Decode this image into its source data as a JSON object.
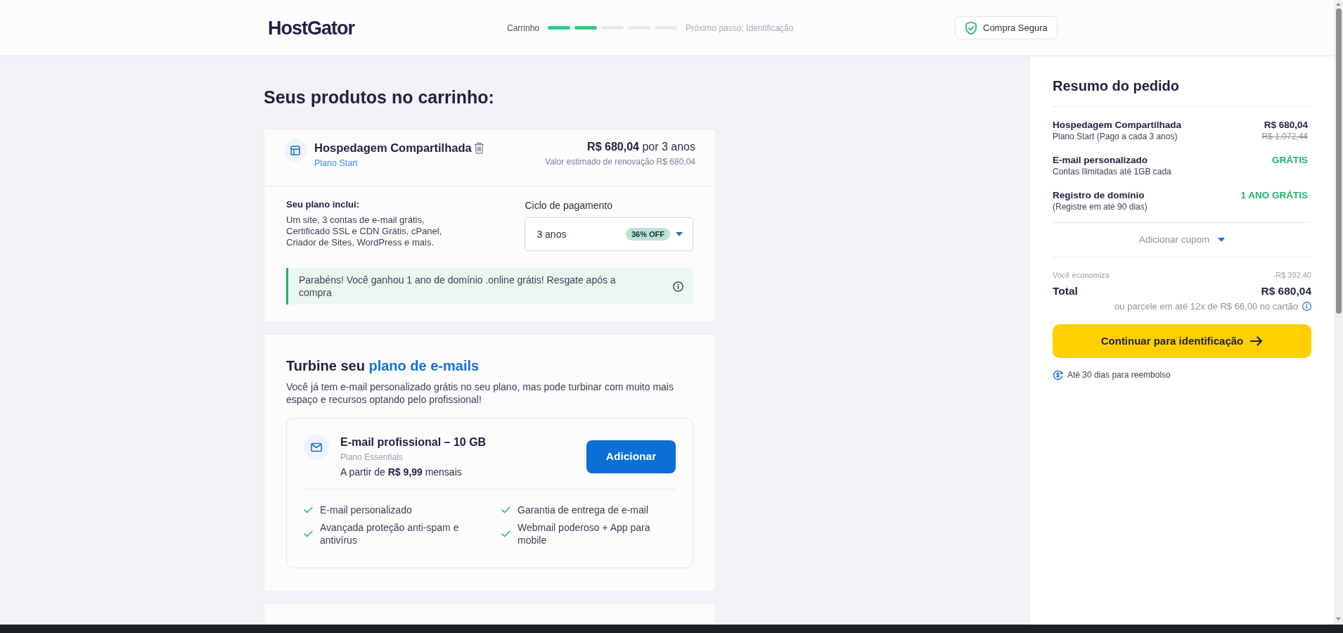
{
  "header": {
    "logo": "HostGator",
    "progress": {
      "label": "Carrinho",
      "steps": [
        {
          "done": true
        },
        {
          "done": true
        },
        {
          "done": false
        },
        {
          "done": false
        },
        {
          "done": false
        }
      ],
      "next_step": "Próximo passo: Identificação"
    },
    "secure_badge": "Compra Segura"
  },
  "cart": {
    "title": "Seus produtos no carrinho:",
    "product": {
      "name": "Hospedagem Compartilhada",
      "plan": "Plano Start",
      "price_line": "**R$ 680,04** por 3 anos",
      "renewal": "Valor estimado de renovação R$ 680,04",
      "includes_title": "Seu plano inclui:",
      "includes_text": "Um site, 3 contas de e-mail grátis, Certificado SSL e CDN Grátis, cPanel, Criador de Sites, WordPress e mais.",
      "billing_label": "Ciclo de pagamento",
      "billing_value": "3 anos",
      "billing_badge": "36% OFF",
      "notice": "Parabéns! Você ganhou 1 ano de domínio .online grátis! Resgate após a compra"
    }
  },
  "upsell": {
    "title": "Turbine seu",
    "title_highlight": "plano de e-mails",
    "description": "Você já tem e-mail personalizado grátis no seu plano, mas pode turbinar com muito mais espaço e recursos optando pelo profissional!",
    "offer": {
      "name": "E-mail profissional – 10 GB",
      "plan": "Plano Essentials",
      "price_line": "A partir de **R$ 9,99** mensais",
      "button": "Adicionar",
      "features": [
        "E-mail personalizado",
        "Garantia de entrega de e-mail",
        "Avançada proteção anti-spam e antivírus",
        "Webmail poderoso + App para mobile"
      ]
    }
  },
  "summary": {
    "title": "Resumo do pedido",
    "items": [
      {
        "kind": "paid",
        "name": "Hospedagem Compartilhada",
        "detail": "Plano Start (Pago a cada 3 anos)",
        "price": "R$ 680,04",
        "old_price": "R$ 1.072,44"
      },
      {
        "kind": "free",
        "name": "E-mail personalizado",
        "detail": "Contas Ilimitadas até 1GB cada",
        "price": "GRÁTIS"
      },
      {
        "kind": "free",
        "name": "Registro de domínio",
        "detail": "(Registre em até 90 dias)",
        "price": "1 ANO GRÁTIS"
      }
    ],
    "coupon": "Adicionar cupom",
    "savings_label": "Você economiza",
    "savings_value": "-R$ 392,40",
    "total_label": "Total",
    "total_value": "R$ 680,04",
    "installments": "ou parcele em até 12x de R$ 66,00 no cartão",
    "button": "Continuar para identificação",
    "refund": "Até 30 dias para reembolso"
  }
}
